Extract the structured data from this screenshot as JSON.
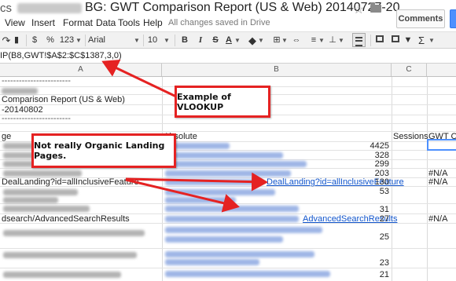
{
  "header": {
    "title_prefix": "cs",
    "doc_title": "BG: GWT Comparison Report (US & Web) 20140727-20...",
    "star_icon": "star-icon",
    "folder_icon": "folder-icon",
    "comments_label": "Comments"
  },
  "menu": {
    "items": [
      "View",
      "Insert",
      "Format",
      "Data",
      "Tools",
      "Help"
    ],
    "save_status": "All changes saved in Drive"
  },
  "toolbar": {
    "currency": "$",
    "percent": "%",
    "number_format": "123",
    "font_name": "Arial",
    "font_size": "10",
    "bold": "B",
    "italic": "I",
    "strike": "S",
    "text_color": "A",
    "sigma": "Σ"
  },
  "formula": {
    "text": "IP(B8,GWT!$A$2:$C$1387,3,0)"
  },
  "columns": {
    "a": "A",
    "b": "B",
    "c": "C"
  },
  "sheet": {
    "dashes_1": "------------------------",
    "report_name": "Comparison Report (US & Web)",
    "date_range": "-20140802",
    "dashes_2": "------------------------",
    "col_a_header": "ge",
    "col_b_header": "Absolute",
    "col_c_header": "Sessions",
    "col_d_header": "GWT Cli",
    "rows": [
      {
        "a": "",
        "b": "",
        "c": "4425",
        "d": ""
      },
      {
        "a": "",
        "b": "",
        "c": "328",
        "d": ""
      },
      {
        "a": "",
        "b": "",
        "c": "299",
        "d": ""
      },
      {
        "a": "",
        "b": "",
        "c": "203",
        "d": "#N/A"
      },
      {
        "a": "DealLanding?id=allInclusiveFeature",
        "b": "DealLanding?id=allInclusiveFeature",
        "c": "130",
        "d": "#N/A"
      },
      {
        "a": "",
        "b": "",
        "c": "53",
        "d": ""
      },
      {
        "a": "",
        "b": "",
        "c": "31",
        "d": ""
      },
      {
        "a": "dsearch/AdvancedSearchResults",
        "b": "AdvancedSearchResults",
        "c": "27",
        "d": "#N/A"
      },
      {
        "a": "",
        "b": "",
        "c": "25",
        "d": ""
      },
      {
        "a": "",
        "b": "",
        "c": "23",
        "d": ""
      },
      {
        "a": "",
        "b": "",
        "c": "21",
        "d": ""
      }
    ]
  },
  "annotations": {
    "vlookup": "Example of VLOOKUP",
    "organic": "Not really Organic Landing Pages.",
    "border_color": "#e52222"
  }
}
